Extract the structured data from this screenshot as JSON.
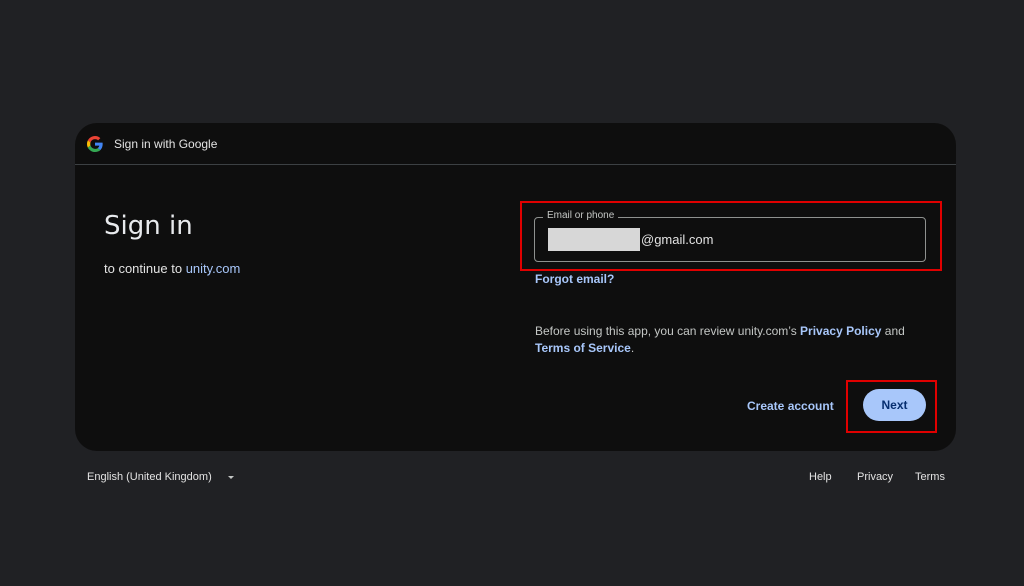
{
  "header": {
    "title": "Sign in with Google"
  },
  "main": {
    "title": "Sign in",
    "continue_prefix": "to continue to",
    "site": "unity.com"
  },
  "email": {
    "label": "Email or phone",
    "value_suffix": "@gmail.com"
  },
  "links": {
    "forgot_email": "Forgot email?",
    "create_account": "Create account"
  },
  "policy": {
    "prefix": "Before using this app, you can review unity.com’s",
    "privacy_policy": "Privacy Policy",
    "and": "and",
    "terms_of_service": "Terms of Service",
    "suffix": "."
  },
  "buttons": {
    "next": "Next"
  },
  "footer": {
    "language": "English (United Kingdom)",
    "help": "Help",
    "privacy": "Privacy",
    "terms": "Terms"
  },
  "colors": {
    "background": "#202124",
    "card": "#0e0e0e",
    "accent": "#a8c7fa",
    "highlight": "#e00000"
  },
  "icons": [
    "google-logo-icon",
    "dropdown-caret-icon"
  ]
}
